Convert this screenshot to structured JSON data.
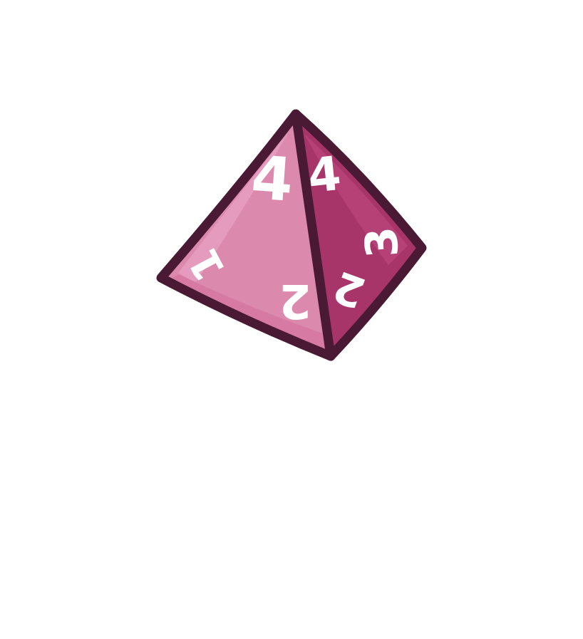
{
  "die": {
    "type": "d4",
    "colors": {
      "outline": "#4a1a34",
      "left_face": "#db89ad",
      "left_face_highlight": "#e9a3c3",
      "right_face": "#a8356a",
      "right_face_highlight": "#c14a82",
      "numerals": "#ffffff"
    },
    "left_face": {
      "top_number": "4",
      "left_number": "1",
      "bottom_number": "2"
    },
    "right_face": {
      "top_number": "4",
      "right_number": "3",
      "bottom_number": "2"
    }
  }
}
